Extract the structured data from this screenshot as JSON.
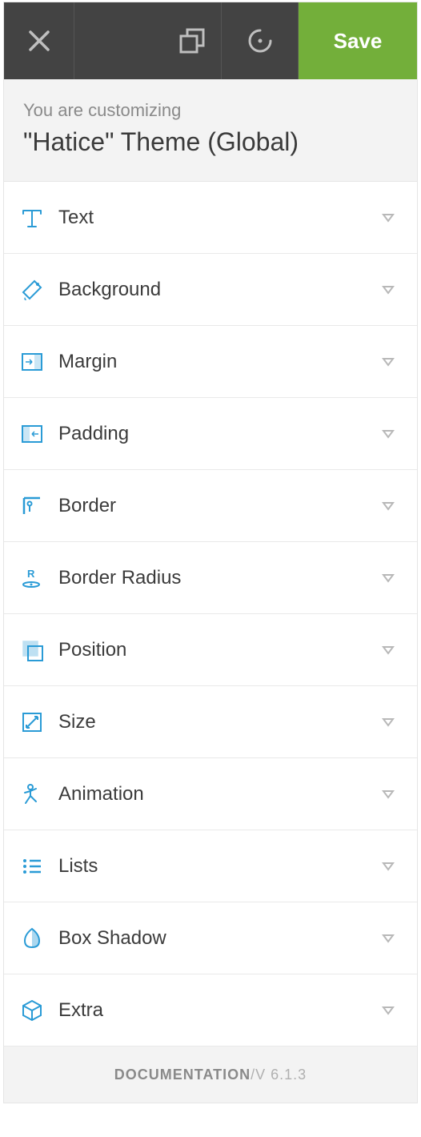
{
  "toolbar": {
    "save_label": "Save"
  },
  "header": {
    "subtitle": "You are customizing",
    "title": "\"Hatice\" Theme (Global)"
  },
  "sections": [
    {
      "icon": "text-icon",
      "label": "Text"
    },
    {
      "icon": "background-icon",
      "label": "Background"
    },
    {
      "icon": "margin-icon",
      "label": "Margin"
    },
    {
      "icon": "padding-icon",
      "label": "Padding"
    },
    {
      "icon": "border-icon",
      "label": "Border"
    },
    {
      "icon": "border-radius-icon",
      "label": "Border Radius"
    },
    {
      "icon": "position-icon",
      "label": "Position"
    },
    {
      "icon": "size-icon",
      "label": "Size"
    },
    {
      "icon": "animation-icon",
      "label": "Animation"
    },
    {
      "icon": "lists-icon",
      "label": "Lists"
    },
    {
      "icon": "box-shadow-icon",
      "label": "Box Shadow"
    },
    {
      "icon": "extra-icon",
      "label": "Extra"
    }
  ],
  "footer": {
    "doc_label": "DOCUMENTATION",
    "separator": " / ",
    "version": "V 6.1.3"
  }
}
